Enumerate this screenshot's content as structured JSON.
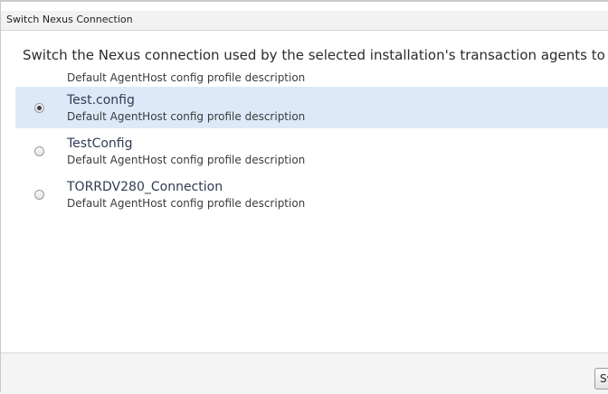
{
  "dialog": {
    "title": "Switch Nexus Connection",
    "description": "Switch the Nexus connection used by the selected installation's transaction agents to"
  },
  "options": [
    {
      "title": "",
      "subtitle": "Default AgentHost config profile description",
      "selected": false
    },
    {
      "title": "Test.config",
      "subtitle": "Default AgentHost config profile description",
      "selected": true
    },
    {
      "title": "TestConfig",
      "subtitle": "Default AgentHost config profile description",
      "selected": false
    },
    {
      "title": "TORRDV280_Connection",
      "subtitle": "Default AgentHost config profile description",
      "selected": false
    }
  ],
  "footer": {
    "switch_label": "Sw"
  },
  "colors": {
    "selected_row": "#dde9f8",
    "title_text": "#2f3c55"
  }
}
